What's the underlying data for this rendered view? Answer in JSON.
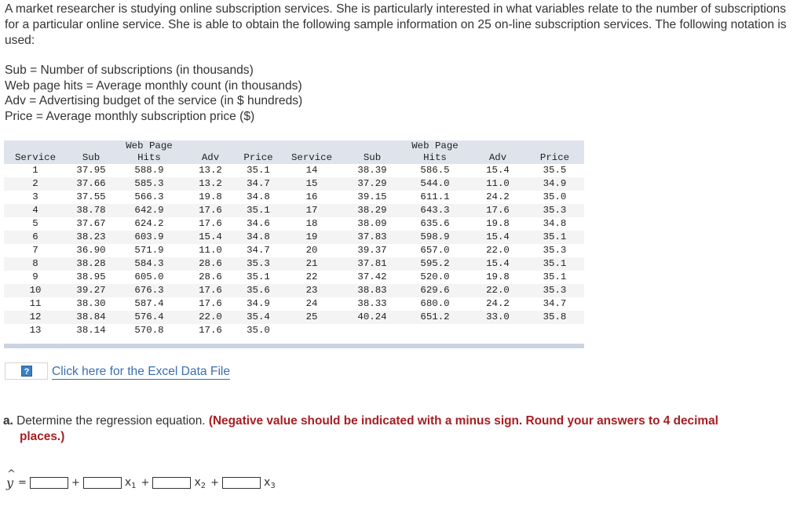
{
  "intro": {
    "paragraph": "A market researcher is studying online subscription services. She is particularly interested in what variables relate to the number of subscriptions for a particular online service. She is able to obtain the following sample information on 25 on-line subscription services. The following notation is used:",
    "definitions": [
      "Sub = Number of subscriptions (in thousands)",
      "Web page hits = Average monthly count (in thousands)",
      "Adv = Advertising budget of the service (in $ hundreds)",
      "Price = Average monthly subscription price ($)"
    ]
  },
  "table": {
    "header_top": [
      "",
      "",
      "Web Page",
      "",
      "",
      "",
      "",
      "Web Page",
      "",
      ""
    ],
    "headers": [
      "Service",
      "Sub",
      "Hits",
      "Adv",
      "Price",
      "Service",
      "Sub",
      "Hits",
      "Adv",
      "Price"
    ],
    "left_rows": [
      [
        "1",
        "37.95",
        "588.9",
        "13.2",
        "35.1"
      ],
      [
        "2",
        "37.66",
        "585.3",
        "13.2",
        "34.7"
      ],
      [
        "3",
        "37.55",
        "566.3",
        "19.8",
        "34.8"
      ],
      [
        "4",
        "38.78",
        "642.9",
        "17.6",
        "35.1"
      ],
      [
        "5",
        "37.67",
        "624.2",
        "17.6",
        "34.6"
      ],
      [
        "6",
        "38.23",
        "603.9",
        "15.4",
        "34.8"
      ],
      [
        "7",
        "36.90",
        "571.9",
        "11.0",
        "34.7"
      ],
      [
        "8",
        "38.28",
        "584.3",
        "28.6",
        "35.3"
      ],
      [
        "9",
        "38.95",
        "605.0",
        "28.6",
        "35.1"
      ],
      [
        "10",
        "39.27",
        "676.3",
        "17.6",
        "35.6"
      ],
      [
        "11",
        "38.30",
        "587.4",
        "17.6",
        "34.9"
      ],
      [
        "12",
        "38.84",
        "576.4",
        "22.0",
        "35.4"
      ],
      [
        "13",
        "38.14",
        "570.8",
        "17.6",
        "35.0"
      ]
    ],
    "right_rows": [
      [
        "14",
        "38.39",
        "586.5",
        "15.4",
        "35.5"
      ],
      [
        "15",
        "37.29",
        "544.0",
        "11.0",
        "34.9"
      ],
      [
        "16",
        "39.15",
        "611.1",
        "24.2",
        "35.0"
      ],
      [
        "17",
        "38.29",
        "643.3",
        "17.6",
        "35.3"
      ],
      [
        "18",
        "38.09",
        "635.6",
        "19.8",
        "34.8"
      ],
      [
        "19",
        "37.83",
        "598.9",
        "15.4",
        "35.1"
      ],
      [
        "20",
        "39.37",
        "657.0",
        "22.0",
        "35.3"
      ],
      [
        "21",
        "37.81",
        "595.2",
        "15.4",
        "35.1"
      ],
      [
        "22",
        "37.42",
        "520.0",
        "19.8",
        "35.1"
      ],
      [
        "23",
        "38.83",
        "629.6",
        "22.0",
        "35.3"
      ],
      [
        "24",
        "38.33",
        "680.0",
        "24.2",
        "34.7"
      ],
      [
        "25",
        "40.24",
        "651.2",
        "33.0",
        "35.8"
      ],
      [
        "",
        "",
        "",
        "",
        ""
      ]
    ]
  },
  "excel": {
    "help_icon_glyph": "?",
    "link_text": "Click here for the Excel Data File"
  },
  "question": {
    "label": "a.",
    "text": "Determine the regression equation.",
    "hint_line1": "(Negative value should be indicated with a minus sign. Round your answers to 4 decimal",
    "hint_line2": "places.)"
  },
  "equation": {
    "lhs": "y",
    "hat": "^",
    "equals": "=",
    "plus": "+",
    "vars": [
      {
        "name": "x",
        "sub": "1"
      },
      {
        "name": "x",
        "sub": "2"
      },
      {
        "name": "x",
        "sub": "3"
      }
    ],
    "inputs": [
      {
        "value": ""
      },
      {
        "value": ""
      },
      {
        "value": ""
      },
      {
        "value": ""
      }
    ]
  },
  "colors": {
    "header_bg": "#dfe3ec",
    "stripe_bg": "#f4f4f4",
    "link": "#3a6fb0",
    "hint": "#a61e22"
  }
}
